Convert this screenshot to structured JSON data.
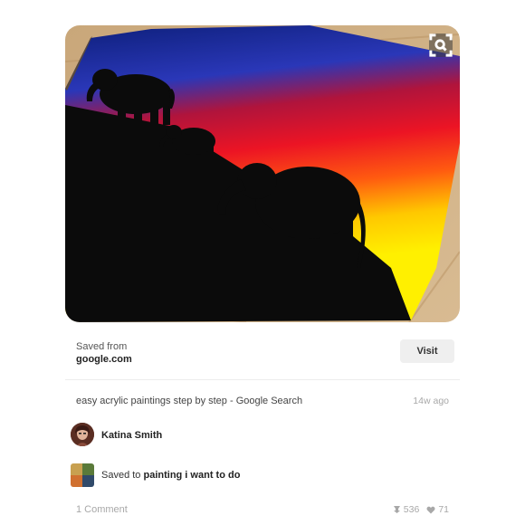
{
  "pin": {
    "image_alt": "Elephant silhouettes acrylic painting",
    "saved_from_label": "Saved from",
    "source_site": "google.com",
    "visit_label": "Visit",
    "description": "easy acrylic paintings step by step - Google Search",
    "time_ago": "14w ago"
  },
  "user": {
    "name": "Katina Smith"
  },
  "board": {
    "saved_to_label": "Saved to",
    "name": "painting i want to do"
  },
  "footer": {
    "comments": "1 Comment",
    "repins": "536",
    "likes": "71"
  },
  "icons": {
    "lens": "visual-search-icon",
    "repin": "pin-icon",
    "like": "heart-icon"
  },
  "colors": {
    "visit_bg": "#efefef",
    "muted_text": "#a8a8a8",
    "sky_top": "#1b2f8f",
    "sky_mid": "#e8132a",
    "sky_low": "#ffe800"
  }
}
